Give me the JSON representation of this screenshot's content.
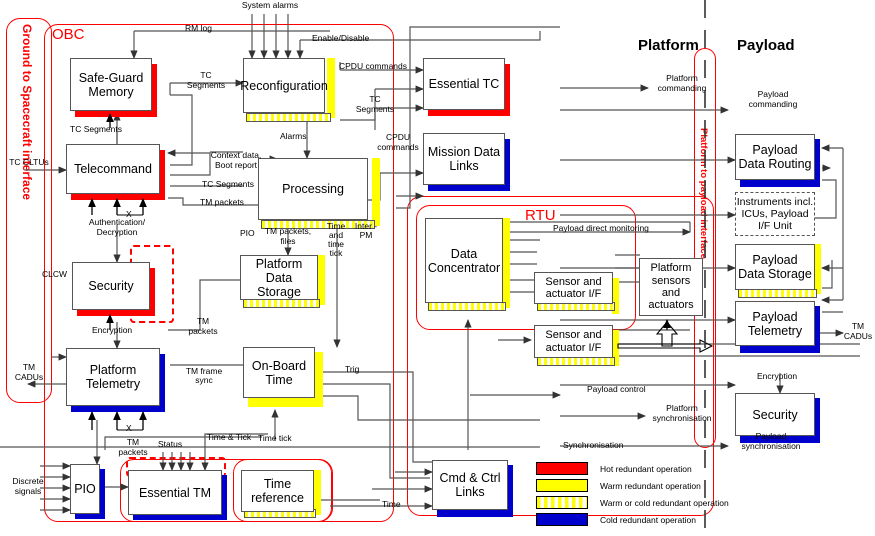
{
  "headers": {
    "platform": "Platform",
    "payload": "Payload"
  },
  "groups": {
    "ground": {
      "label": "Ground to Spacecraft interface"
    },
    "obc": {
      "label": "OBC"
    },
    "rtu": {
      "label": "RTU"
    },
    "interface": {
      "label": "Platform to payload interface"
    }
  },
  "boxes": {
    "safeguard": {
      "label": "Safe-Guard Memory",
      "redundancy": "hot"
    },
    "telecommand": {
      "label": "Telecommand",
      "redundancy": "hot"
    },
    "security_pf": {
      "label": "Security",
      "redundancy": "hot"
    },
    "platform_tm": {
      "label": "Platform Telemetry",
      "redundancy": "cold"
    },
    "pio": {
      "label": "PIO",
      "redundancy": "cold"
    },
    "essential_tm": {
      "label": "Essential TM",
      "redundancy": "cold"
    },
    "reconfig": {
      "label": "Reconfiguration",
      "redundancy": "warmcold"
    },
    "processing": {
      "label": "Processing",
      "redundancy": "warmcold"
    },
    "pf_storage": {
      "label": "Platform Data Storage",
      "redundancy": "warmcold"
    },
    "obt": {
      "label": "On-Board Time",
      "redundancy": "warm"
    },
    "time_ref": {
      "label": "Time reference",
      "redundancy": "warmcold"
    },
    "essential_tc": {
      "label": "Essential TC",
      "redundancy": "hot"
    },
    "mission_dl": {
      "label": "Mission Data Links",
      "redundancy": "cold"
    },
    "data_conc": {
      "label": "Data Concentrator",
      "redundancy": "warmcold"
    },
    "sensor_if_1": {
      "label": "Sensor and actuator I/F",
      "redundancy": "warmcold"
    },
    "sensor_if_2": {
      "label": "Sensor and actuator I/F",
      "redundancy": "warmcold"
    },
    "pf_sensors": {
      "label": "Platform sensors and actuators",
      "redundancy": "none"
    },
    "cmd_ctrl": {
      "label": "Cmd & Ctrl Links",
      "redundancy": "cold"
    },
    "pl_routing": {
      "label": "Payload Data Routing",
      "redundancy": "cold"
    },
    "instruments": {
      "label": "Instruments incl. ICUs, Payload I/F Unit",
      "redundancy": "dashed"
    },
    "pl_storage": {
      "label": "Payload Data Storage",
      "redundancy": "warmcold"
    },
    "pl_telemetry": {
      "label": "Payload Telemetry",
      "redundancy": "cold"
    },
    "security_pl": {
      "label": "Security",
      "redundancy": "cold"
    }
  },
  "signals": {
    "system_alarms": "System alarms",
    "rm_log": "RM log",
    "enable_disable": "Enable/Disable",
    "cpdu_commands_1": "CPDU commands",
    "cpdu_commands_2": "CPDU commands",
    "tc_segments_1": "TC Segments",
    "tc_segments_2": "TC Segments",
    "tc_segments_3": "TC Segments",
    "tc_segments_4": "TC Segments",
    "alarms": "Alarms",
    "context_boot": "Context data, Boot report",
    "tm_packets_1": "TM packets",
    "tm_packets_2": "TM packets",
    "tm_packets_3": "TM packets",
    "tm_packets_files": "TM packets, files",
    "time_and_tick": "Time and time tick",
    "inter_pm": "Inter -PM",
    "pio": "PIO",
    "authentication": "Authentication/ Decryption",
    "encryption_pf": "Encryption",
    "encryption_pl": "Encryption",
    "clcw": "CLCW",
    "tc_cltus": "TC CLTUs",
    "tm_cadus_left": "TM CADUs",
    "tm_cadus_right": "TM CADUs",
    "discrete_signals": "Discrete signals",
    "tm_frame_sync": "TM frame sync",
    "time_tick": "Time tick",
    "time_and_tick_label": "Time & Tick",
    "status": "Status",
    "trig": "Trig",
    "time": "Time",
    "platform_commanding": "Platform commanding",
    "payload_commanding": "Payload commanding",
    "payload_direct_monitoring": "Payload direct monitoring",
    "payload_control": "Payload control",
    "platform_synchronisation": "Platform synchronisation",
    "payload_synchronisation": "Payload synchronisation",
    "synchronisation": "Synchronisation",
    "x1": "X",
    "x2": "X"
  },
  "legend": {
    "items": [
      {
        "color": "#ff0000",
        "swatch": "red",
        "text": "Hot redundant operation"
      },
      {
        "color": "#ffff00",
        "swatch": "yellow",
        "text": "Warm redundant operation"
      },
      {
        "color": "#ffff00",
        "swatch": "mix",
        "text": "Warm or cold redundant operation"
      },
      {
        "color": "#0000cc",
        "swatch": "blue",
        "text": "Cold redundant operation"
      }
    ]
  }
}
